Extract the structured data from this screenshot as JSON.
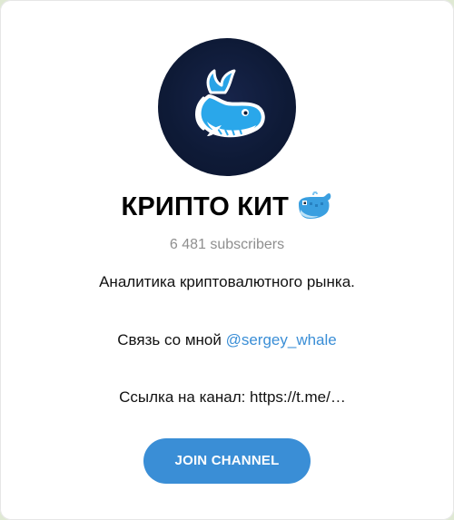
{
  "channel": {
    "title": "КРИПТО КИТ",
    "title_emoji": "whale-emoji",
    "subscribers": "6 481 subscribers",
    "description": {
      "line1": "Аналитика криптовалютного рынка.",
      "contact_prefix": "Связь со мной ",
      "contact_handle": "@sergey_whale",
      "link_line": "Ссылка на канал: https://t.me/…"
    },
    "avatar_icon": "whale-logo"
  },
  "actions": {
    "join_label": "JOIN CHANNEL"
  },
  "colors": {
    "accent": "#3a8ed6",
    "avatar_bg": "#0e1a36",
    "muted_text": "#8f8f8f",
    "page_bg": "#dfe9d3"
  }
}
